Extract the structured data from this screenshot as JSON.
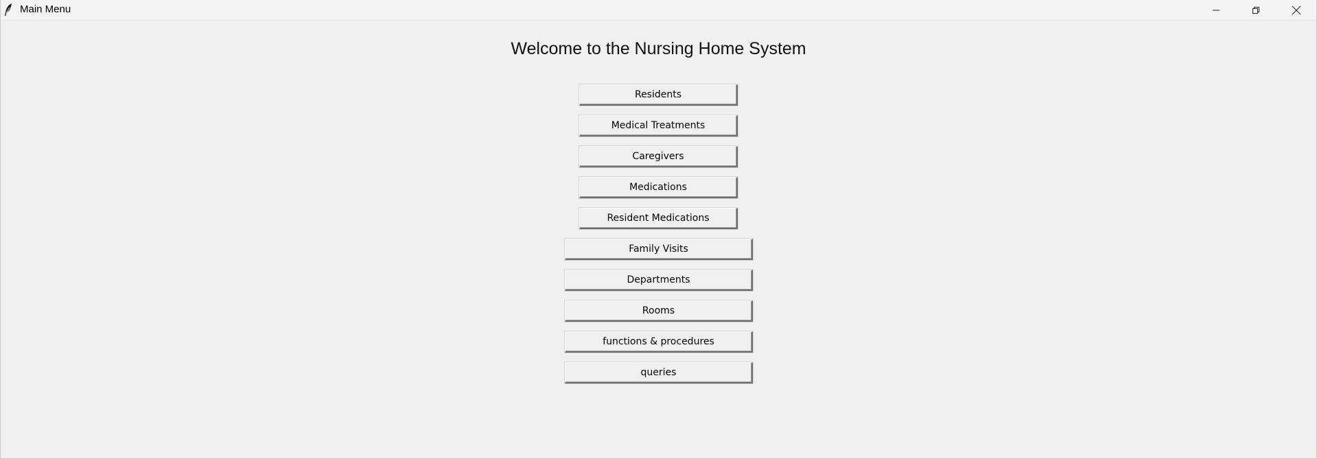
{
  "window": {
    "title": "Main Menu",
    "app_icon": "feather-icon",
    "controls": [
      "minimize-icon",
      "restore-icon",
      "close-icon"
    ]
  },
  "main": {
    "heading": "Welcome to the Nursing Home System",
    "buttons": [
      {
        "label": "Residents"
      },
      {
        "label": "Medical Treatments"
      },
      {
        "label": "Caregivers"
      },
      {
        "label": "Medications"
      },
      {
        "label": "Resident Medications"
      },
      {
        "label": "Family Visits"
      },
      {
        "label": "Departments"
      },
      {
        "label": "Rooms"
      },
      {
        "label": "functions & procedures"
      },
      {
        "label": "queries"
      }
    ]
  }
}
